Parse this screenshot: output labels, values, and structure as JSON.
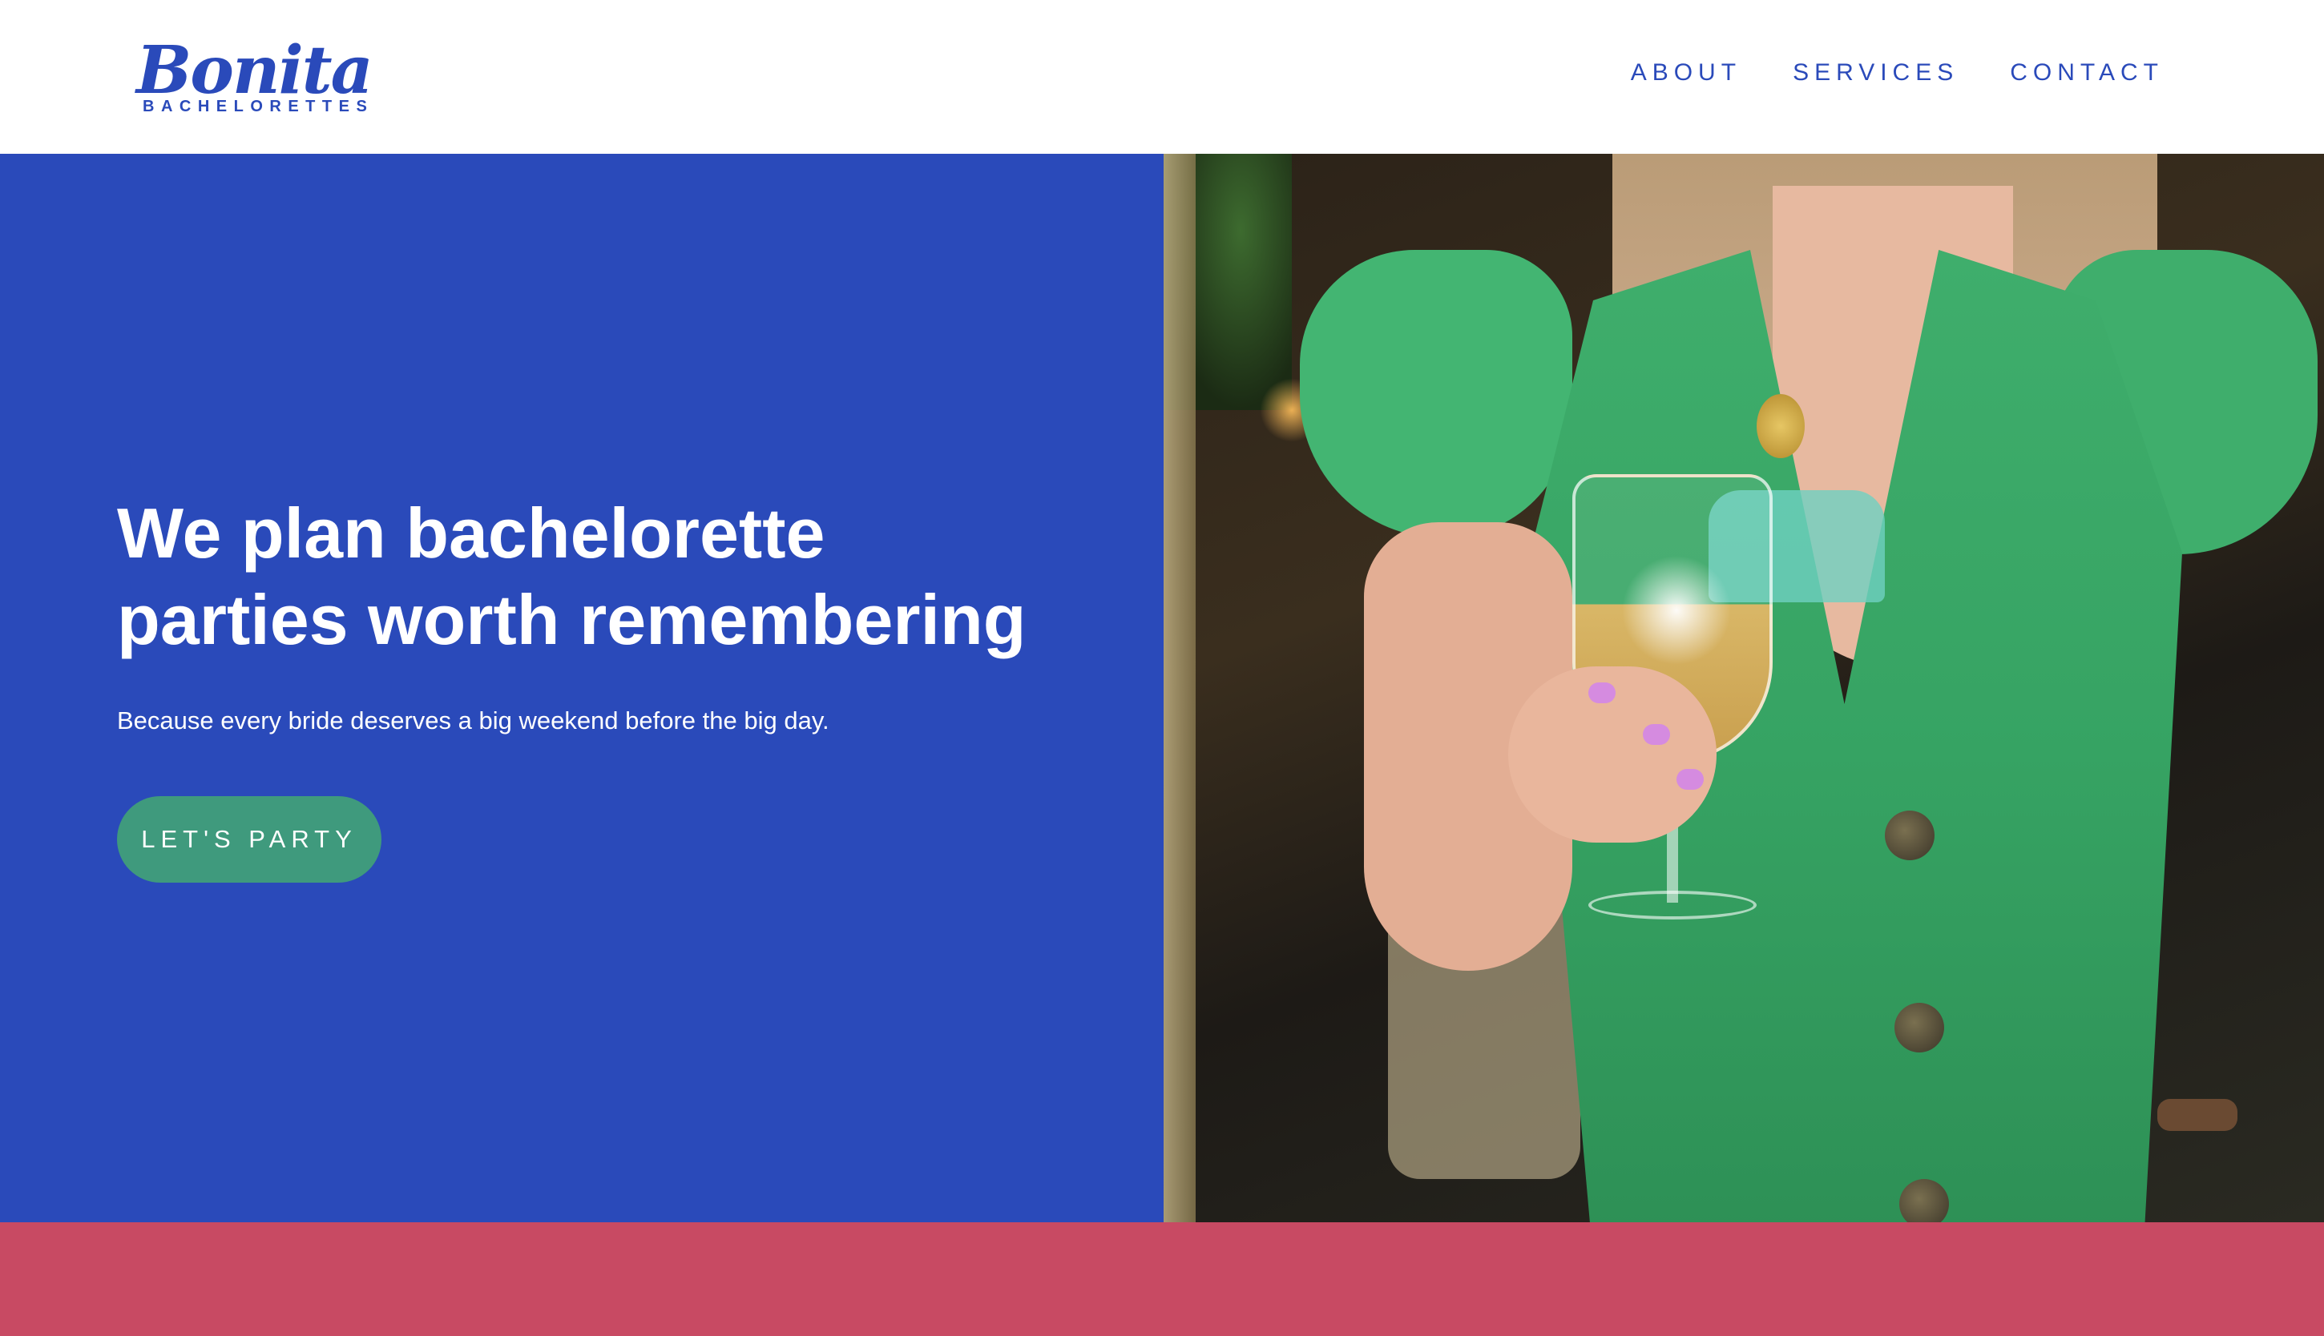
{
  "brand": {
    "name": "Bonita",
    "tagline": "BACHELORETTES",
    "color": "#2a4aba"
  },
  "nav": {
    "items": [
      {
        "label": "ABOUT"
      },
      {
        "label": "SERVICES"
      },
      {
        "label": "CONTACT"
      }
    ]
  },
  "hero": {
    "title_line1": "We plan bachelorette",
    "title_line2": "parties worth remembering",
    "subtitle": "Because every bride deserves a big weekend before the big day.",
    "cta_label": "LET'S PARTY",
    "background_color": "#2a4aba",
    "cta_color": "#3f9a7d"
  },
  "photo": {
    "subject": "woman in green dress holding wine glass"
  },
  "footer_band": {
    "color": "#c84a63"
  }
}
